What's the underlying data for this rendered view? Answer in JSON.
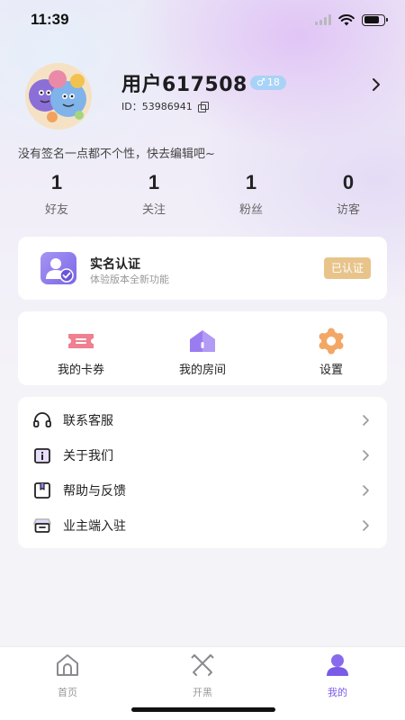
{
  "status_bar": {
    "time": "11:39"
  },
  "profile": {
    "username": "用户617508",
    "gender_symbol": "♂",
    "age": "18",
    "user_id": "ID：53986941",
    "signature": "没有签名一点都不个性，快去编辑吧~"
  },
  "stats": [
    {
      "value": "1",
      "label": "好友"
    },
    {
      "value": "1",
      "label": "关注"
    },
    {
      "value": "1",
      "label": "粉丝"
    },
    {
      "value": "0",
      "label": "访客"
    }
  ],
  "verification": {
    "title": "实名认证",
    "subtitle": "体验版本全新功能",
    "badge": "已认证"
  },
  "shortcuts": [
    {
      "label": "我的卡券",
      "icon": "ticket-icon"
    },
    {
      "label": "我的房间",
      "icon": "house-icon"
    },
    {
      "label": "设置",
      "icon": "gear-icon"
    }
  ],
  "menu": [
    {
      "label": "联系客服",
      "icon": "headset-icon"
    },
    {
      "label": "关于我们",
      "icon": "info-icon"
    },
    {
      "label": "帮助与反馈",
      "icon": "feedback-icon"
    },
    {
      "label": "业主端入驻",
      "icon": "store-icon"
    }
  ],
  "tabs": [
    {
      "label": "首页",
      "icon": "home-icon",
      "active": false
    },
    {
      "label": "开黑",
      "icon": "controller-icon",
      "active": false
    },
    {
      "label": "我的",
      "icon": "profile-icon",
      "active": true
    }
  ],
  "colors": {
    "accent": "#7a5ae8",
    "badge_gold": "#e8c48b",
    "gender_blue": "#a9d3f6"
  }
}
